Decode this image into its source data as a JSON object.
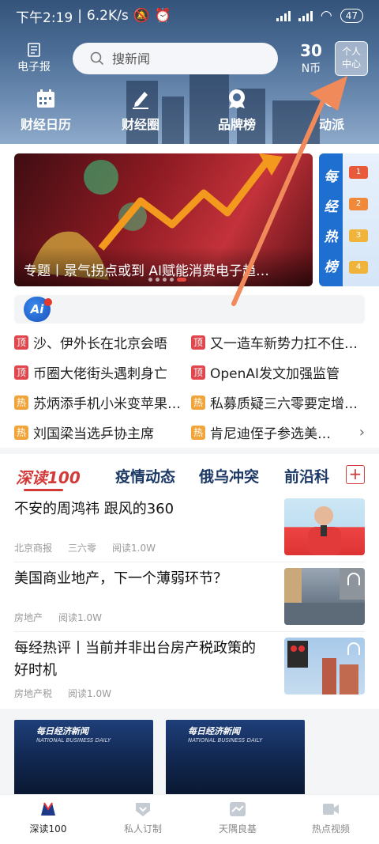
{
  "statusbar": {
    "time": "下午2:19",
    "speed": "6.2K/s",
    "battery": "47"
  },
  "topbar": {
    "epaper_label": "电子报",
    "search_placeholder": "搜新闻",
    "coins_value": "30",
    "coins_unit": "N币",
    "center_line1": "个人",
    "center_line2": "中心"
  },
  "quicknav": [
    {
      "label": "财经日历",
      "icon": "calendar-icon"
    },
    {
      "label": "财经圈",
      "icon": "pen-icon"
    },
    {
      "label": "品牌榜",
      "icon": "badge-icon"
    },
    {
      "label": "动派",
      "icon": "activity-icon"
    }
  ],
  "banner": {
    "caption": "专题丨景气拐点或到 AI赋能消费电子趋…"
  },
  "hotlist": {
    "title_chars": [
      "每",
      "经",
      "热",
      "榜"
    ],
    "ranks": [
      "1",
      "2",
      "3",
      "4"
    ]
  },
  "ai_bar": {
    "logo_text": "Ai"
  },
  "headlines": [
    {
      "tag": "顶",
      "type": "top",
      "text": "沙、伊外长在北京会晤"
    },
    {
      "tag": "顶",
      "type": "top",
      "text": "又一造车新势力扛不住…"
    },
    {
      "tag": "顶",
      "type": "top",
      "text": "币圈大佬街头遇刺身亡"
    },
    {
      "tag": "顶",
      "type": "top",
      "text": "OpenAI发文加强监管"
    },
    {
      "tag": "热",
      "type": "hot",
      "text": "苏炳添手机小米变苹果…"
    },
    {
      "tag": "热",
      "type": "hot",
      "text": "私募质疑三六零要定增…"
    },
    {
      "tag": "热",
      "type": "hot",
      "text": "刘国梁当选乒协主席"
    },
    {
      "tag": "热",
      "type": "hot",
      "text": "肯尼迪侄子参选美…"
    }
  ],
  "tabs": {
    "deep": "深读100",
    "items": [
      "疫情动态",
      "俄乌冲突",
      "前沿科"
    ],
    "plus": "+"
  },
  "articles": [
    {
      "title": "不安的周鸿祎 跟风的360",
      "meta": [
        "北京商报",
        "三六零",
        "阅读1.0W"
      ]
    },
    {
      "title": "美国商业地产，下一个薄弱环节？",
      "meta": [
        "房地产",
        "阅读1.0W"
      ]
    },
    {
      "title": "每经热评丨当前并非出台房产税政策的好时机",
      "meta": [
        "房地产税",
        "阅读1.0W"
      ]
    }
  ],
  "videos": [
    {
      "brand": "每日经济新闻",
      "sub": "NATIONAL BUSINESS DAILY"
    },
    {
      "brand": "每日经济新闻",
      "sub": "NATIONAL BUSINESS DAILY"
    }
  ],
  "bottomnav": [
    {
      "label": "深读100",
      "icon": "deep-read-icon",
      "active": true
    },
    {
      "label": "私人订制",
      "icon": "shield-icon",
      "active": false
    },
    {
      "label": "天隅良基",
      "icon": "chart-icon",
      "active": false
    },
    {
      "label": "热点视频",
      "icon": "video-icon",
      "active": false
    }
  ],
  "colors": {
    "accent_red": "#d33a3a",
    "nav_blue": "#1d3a66",
    "hot_orange": "#f0a43a",
    "top_red": "#e0474c"
  }
}
